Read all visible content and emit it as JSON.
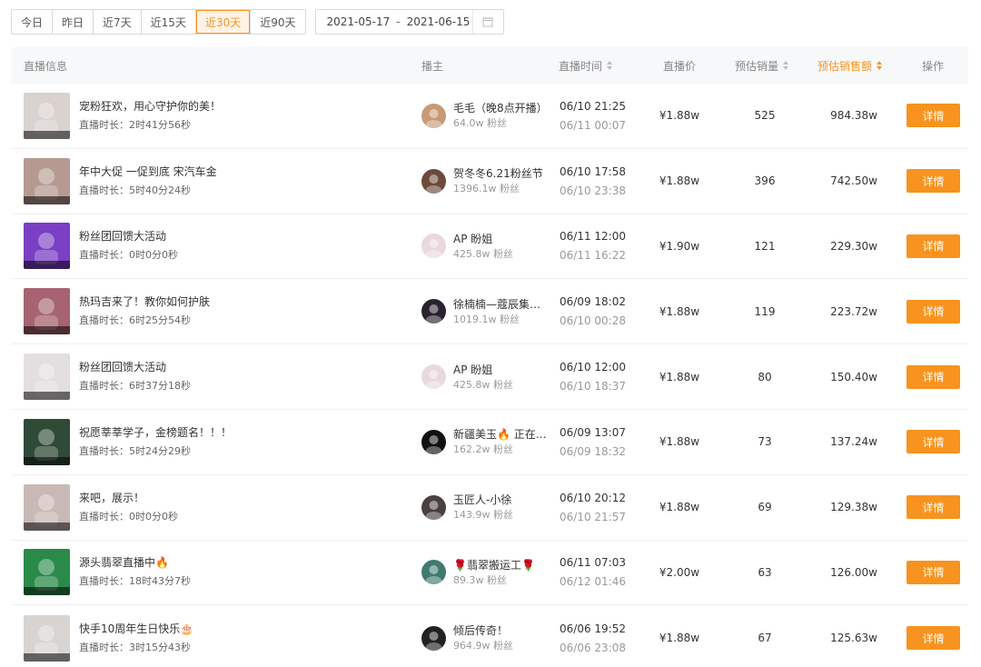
{
  "filters": {
    "ranges": [
      "今日",
      "昨日",
      "近7天",
      "近15天",
      "近30天",
      "近90天"
    ],
    "active_range": "近30天",
    "date_start": "2021-05-17",
    "date_sep": "-",
    "date_end": "2021-06-15"
  },
  "table": {
    "columns": {
      "info": "直播信息",
      "anchor": "播主",
      "time": "直播时间",
      "price": "直播价",
      "sales": "预估销量",
      "revenue": "预估销售额",
      "action": "操作"
    },
    "sorted_column": "revenue",
    "detail_label": "详情",
    "rows": [
      {
        "title": "宠粉狂欢，用心守护你的美！",
        "duration": "直播时长：2时41分56秒",
        "anchor": "毛毛（晚8点开播）",
        "fans": "64.0w 粉丝",
        "start": "06/10 21:25",
        "end": "06/11 00:07",
        "price": "¥1.88w",
        "sales": "525",
        "revenue": "984.38w",
        "thumb_color": "#d9d2cf",
        "avatar_color": "#c79a74"
      },
      {
        "title": "年中大促 一促到底 宋汽车金",
        "duration": "直播时长：5时40分24秒",
        "anchor": "贺冬冬6.21粉丝节",
        "fans": "1396.1w 粉丝",
        "start": "06/10 17:58",
        "end": "06/10 23:38",
        "price": "¥1.88w",
        "sales": "396",
        "revenue": "742.50w",
        "thumb_color": "#b69a92",
        "avatar_color": "#6b4a3a"
      },
      {
        "title": "粉丝团回馈大活动",
        "duration": "直播时长：0时0分0秒",
        "anchor": "AP 盼姐",
        "fans": "425.8w 粉丝",
        "start": "06/11 12:00",
        "end": "06/11 16:22",
        "price": "¥1.90w",
        "sales": "121",
        "revenue": "229.30w",
        "thumb_color": "#7a3fc4",
        "avatar_color": "#e9d8dd"
      },
      {
        "title": "热玛吉来了！教你如何护肤",
        "duration": "直播时长：6时25分54秒",
        "anchor": "徐楠楠—蔻辰集团老板娘",
        "fans": "1019.1w 粉丝",
        "start": "06/09 18:02",
        "end": "06/10 00:28",
        "price": "¥1.88w",
        "sales": "119",
        "revenue": "223.72w",
        "thumb_color": "#a7636f",
        "avatar_color": "#2a2230"
      },
      {
        "title": "粉丝团回馈大活动",
        "duration": "直播时长：6时37分18秒",
        "anchor": "AP 盼姐",
        "fans": "425.8w 粉丝",
        "start": "06/10 12:00",
        "end": "06/10 18:37",
        "price": "¥1.88w",
        "sales": "80",
        "revenue": "150.40w",
        "thumb_color": "#e3dedf",
        "avatar_color": "#e9d8dd"
      },
      {
        "title": "祝愿莘莘学子，金榜题名！！！",
        "duration": "直播时长：5时24分29秒",
        "anchor": "新疆美玉🔥 正在直播",
        "fans": "162.2w 粉丝",
        "start": "06/09 13:07",
        "end": "06/09 18:32",
        "price": "¥1.88w",
        "sales": "73",
        "revenue": "137.24w",
        "thumb_color": "#2f4a37",
        "avatar_color": "#111111"
      },
      {
        "title": "来吧，展示！",
        "duration": "直播时长：0时0分0秒",
        "anchor": "玉匠人-小徐",
        "fans": "143.9w 粉丝",
        "start": "06/10 20:12",
        "end": "06/10 21:57",
        "price": "¥1.88w",
        "sales": "69",
        "revenue": "129.38w",
        "thumb_color": "#c9b9b4",
        "avatar_color": "#4a4040"
      },
      {
        "title": "源头翡翠直播中🔥",
        "duration": "直播时长：18时43分7秒",
        "anchor": "🌹翡翠搬运工🌹",
        "fans": "89.3w 粉丝",
        "start": "06/11 07:03",
        "end": "06/12 01:46",
        "price": "¥2.00w",
        "sales": "63",
        "revenue": "126.00w",
        "thumb_color": "#2a8a4a",
        "avatar_color": "#3f7a70"
      },
      {
        "title": "快手10周年生日快乐🎂",
        "duration": "直播时长：3时15分43秒",
        "anchor": "倾后传奇！",
        "fans": "964.9w 粉丝",
        "start": "06/06 19:52",
        "end": "06/06 23:08",
        "price": "¥1.88w",
        "sales": "67",
        "revenue": "125.63w",
        "thumb_color": "#d8d4d2",
        "avatar_color": "#222222"
      }
    ]
  }
}
